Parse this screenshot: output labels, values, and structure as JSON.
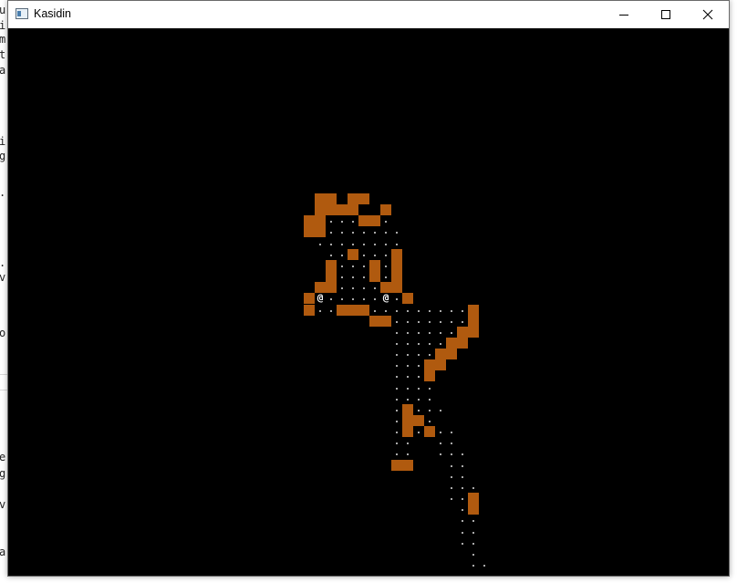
{
  "window": {
    "title": "Kasidin",
    "icons": {
      "app": "app-window-icon",
      "minimize": "minimize-icon",
      "maximize": "maximize-icon",
      "close": "close-icon"
    }
  },
  "background_window": {
    "text_fragments": [
      "u",
      "i",
      "m",
      "t",
      "a",
      "i",
      "g",
      ".",
      ".",
      "v",
      "o",
      "e",
      "g",
      "v",
      "a"
    ]
  },
  "game": {
    "player_glyph": "@",
    "colors": {
      "wall": "#b05a0f",
      "floor": "#a9a9a9",
      "player": "#ffffff",
      "background": "#000000"
    }
  }
}
